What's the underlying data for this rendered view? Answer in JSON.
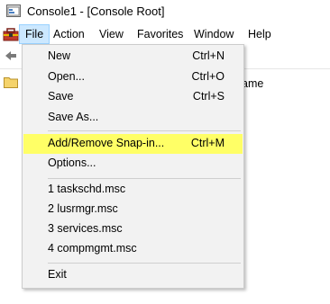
{
  "window": {
    "title": "Console1 - [Console Root]"
  },
  "menubar": {
    "items": [
      {
        "label": "File"
      },
      {
        "label": "Action"
      },
      {
        "label": "View"
      },
      {
        "label": "Favorites"
      },
      {
        "label": "Window"
      },
      {
        "label": "Help"
      }
    ],
    "active": "File"
  },
  "content": {
    "name_header": "ame"
  },
  "file_menu": {
    "items": [
      {
        "label": "New",
        "shortcut": "Ctrl+N"
      },
      {
        "label": "Open...",
        "shortcut": "Ctrl+O"
      },
      {
        "label": "Save",
        "shortcut": "Ctrl+S"
      },
      {
        "label": "Save As...",
        "shortcut": ""
      },
      {
        "label": "Add/Remove Snap-in...",
        "shortcut": "Ctrl+M",
        "highlighted": true
      },
      {
        "label": "Options...",
        "shortcut": ""
      },
      {
        "label": "1 taskschd.msc",
        "shortcut": ""
      },
      {
        "label": "2 lusrmgr.msc",
        "shortcut": ""
      },
      {
        "label": "3 services.msc",
        "shortcut": ""
      },
      {
        "label": "4 compmgmt.msc",
        "shortcut": ""
      },
      {
        "label": "Exit",
        "shortcut": ""
      }
    ]
  },
  "colors": {
    "highlight": "#ffff66",
    "menu_active_bg": "#cce8ff",
    "menu_bg": "#f2f2f2"
  },
  "icons": [
    "mmc-app-icon",
    "toolbox-icon",
    "back-arrow-icon",
    "folder-icon"
  ]
}
